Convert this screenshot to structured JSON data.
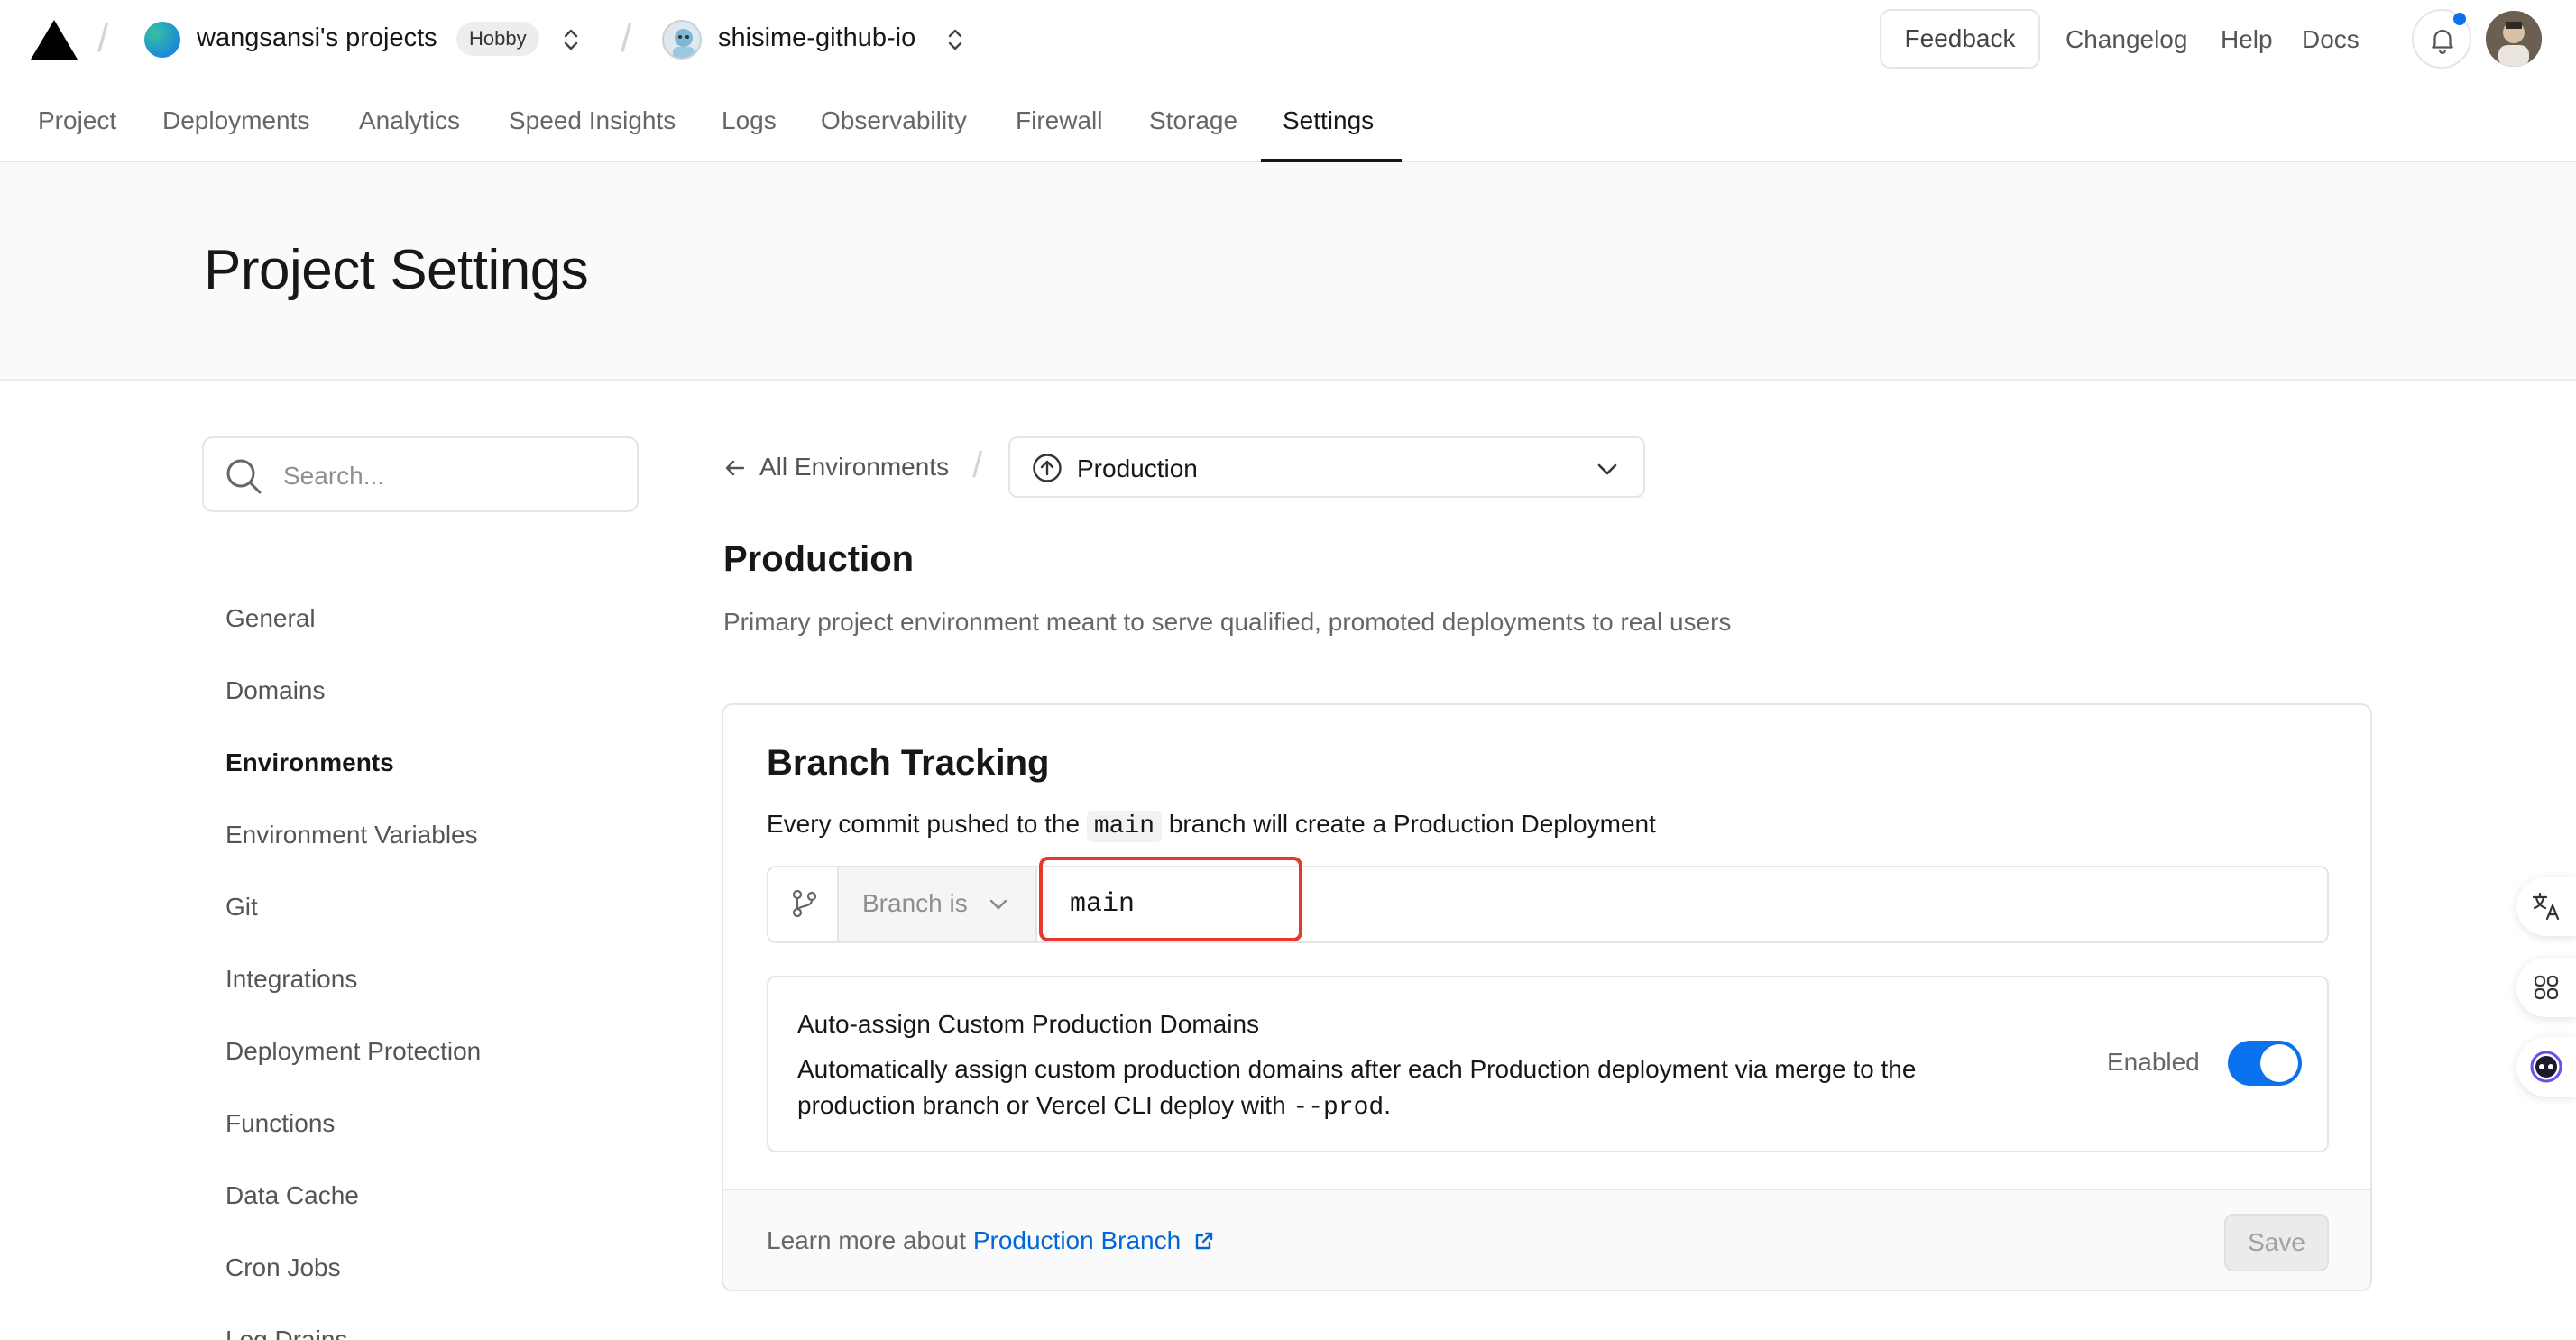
{
  "topbar": {
    "team_name": "wangsansi's projects",
    "plan_badge": "Hobby",
    "project_name": "shisime-github-io",
    "feedback_label": "Feedback",
    "links": [
      "Changelog",
      "Help",
      "Docs"
    ]
  },
  "tabs": [
    "Project",
    "Deployments",
    "Analytics",
    "Speed Insights",
    "Logs",
    "Observability",
    "Firewall",
    "Storage",
    "Settings"
  ],
  "active_tab": "Settings",
  "page_title": "Project Settings",
  "sidebar": {
    "search_placeholder": "Search...",
    "items": [
      "General",
      "Domains",
      "Environments",
      "Environment Variables",
      "Git",
      "Integrations",
      "Deployment Protection",
      "Functions",
      "Data Cache",
      "Cron Jobs",
      "Log Drains"
    ],
    "active_item": "Environments"
  },
  "breadcrumb": {
    "back_label": "All Environments",
    "environment_selected": "Production"
  },
  "section": {
    "title": "Production",
    "description": "Primary project environment meant to serve qualified, promoted deployments to real users"
  },
  "branch_tracking": {
    "title": "Branch Tracking",
    "desc_prefix": "Every commit pushed to the",
    "desc_branch": "main",
    "desc_suffix": "branch will create a Production Deployment",
    "condition_label": "Branch is",
    "branch_value": "main"
  },
  "auto_assign": {
    "title": "Auto-assign Custom Production Domains",
    "desc_line1": "Automatically assign custom production domains after each Production deployment via merge to the",
    "desc_line2_prefix": "production branch or Vercel CLI deploy with",
    "desc_code": "--prod",
    "desc_line2_suffix": ".",
    "status_label": "Enabled",
    "enabled": true
  },
  "footer": {
    "learn_prefix": "Learn more about",
    "learn_link": "Production Branch",
    "save_label": "Save"
  },
  "colors": {
    "accent": "#0a72ef",
    "highlight": "#e5392f",
    "link": "#0068d6"
  }
}
